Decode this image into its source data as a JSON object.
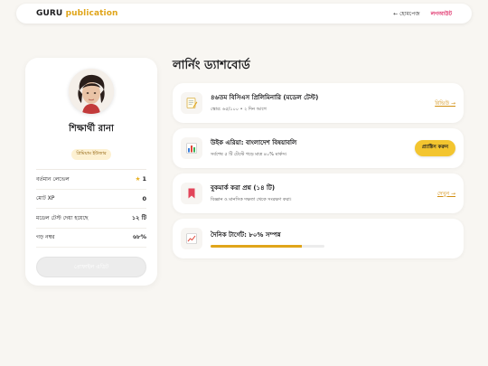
{
  "brand": {
    "name": "GURU",
    "suffix": "publication"
  },
  "nav": {
    "back": "← হোমপেজ",
    "logout": "লগআউট"
  },
  "profile": {
    "name": "শিক্ষার্থী রানা",
    "badge": "প্রিমিয়াম ইউজার",
    "stats": [
      {
        "label": "বর্তমান লেভেল",
        "value": "1",
        "icon": "star-icon"
      },
      {
        "label": "মোট XP",
        "value": "0"
      },
      {
        "label": "মডেল টেস্ট দেয়া হয়েছে",
        "value": "১২ টি"
      },
      {
        "label": "গড় নম্বর",
        "value": "৬৮%"
      }
    ],
    "button_label": "প্রোফাইল এডিট"
  },
  "dashboard": {
    "title": "লার্নিং ড্যাশবোর্ড",
    "cards": [
      {
        "icon": "memo-icon",
        "title": "৪৬তম বিসিএস প্রিলিমিনারি (মডেল টেস্ট)",
        "sub": "স্কোর: ৬৫/১০০ • ২ দিন আগে",
        "action": "রিভিউ →"
      },
      {
        "icon": "chart-icon",
        "title": "উইক এরিয়া: বাংলাদেশ বিষয়াবলি",
        "sub": "সর্বশেষ ৫ টি টেস্টে গড়ে মাত্র ৪০% মার্কস।",
        "action": "প্র্যাক্টিস করুন"
      },
      {
        "icon": "bookmark-icon",
        "title": "বুকমার্ক করা প্রশ্ন (১৪ টি)",
        "sub": "বিজ্ঞান ও মানসিক দক্ষতা থেকে সংরক্ষণ করা।",
        "action": "দেখুন →"
      },
      {
        "icon": "trend-icon",
        "title": "দৈনিক টার্গেট: ৮০% সম্পন্ন",
        "progress": 0.8
      }
    ]
  },
  "colors": {
    "accent": "#e0a51a",
    "logout": "#e0326b",
    "pill": "#f3c52f"
  }
}
